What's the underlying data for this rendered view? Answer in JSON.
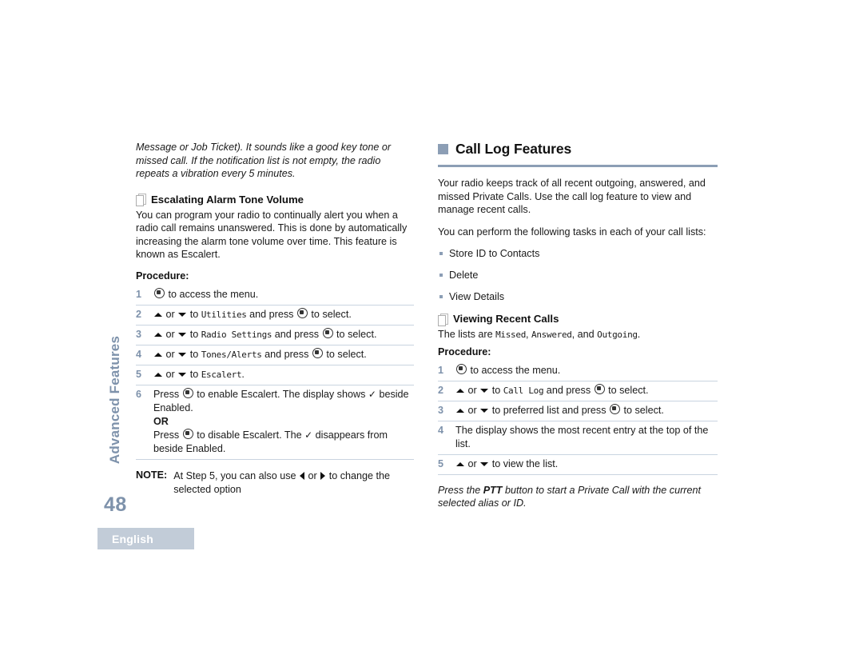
{
  "page": {
    "number": "48",
    "language_chip": "English",
    "chapter_tab": "Advanced Features"
  },
  "left_column": {
    "continued_italic_intro": "Message or Job Ticket). It sounds like a good key tone or missed call. If the notification list is not empty, the radio repeats a vibration every 5 minutes.",
    "section": {
      "heading": "Escalating Alarm Tone Volume",
      "paragraph": "You can program your radio to continually alert you when a radio call remains unanswered. This is done by automatically increasing the alarm tone volume over time. This feature is known as Escalert.",
      "procedure_label": "Procedure:",
      "steps": [
        {
          "num": "1",
          "parts": [
            {
              "type": "menu-key"
            },
            {
              "type": "text",
              "value": " to access the menu."
            }
          ]
        },
        {
          "num": "2",
          "parts": [
            {
              "type": "tri-up"
            },
            {
              "type": "text",
              "value": " or "
            },
            {
              "type": "tri-down"
            },
            {
              "type": "text",
              "value": " to "
            },
            {
              "type": "device",
              "value": "Utilities"
            },
            {
              "type": "text",
              "value": " and press "
            },
            {
              "type": "menu-key"
            },
            {
              "type": "text",
              "value": " to select."
            }
          ]
        },
        {
          "num": "3",
          "parts": [
            {
              "type": "tri-up"
            },
            {
              "type": "text",
              "value": " or "
            },
            {
              "type": "tri-down"
            },
            {
              "type": "text",
              "value": " to "
            },
            {
              "type": "device",
              "value": "Radio Settings"
            },
            {
              "type": "text",
              "value": " and press "
            },
            {
              "type": "menu-key"
            },
            {
              "type": "text",
              "value": " to select."
            }
          ]
        },
        {
          "num": "4",
          "parts": [
            {
              "type": "tri-up"
            },
            {
              "type": "text",
              "value": " or "
            },
            {
              "type": "tri-down"
            },
            {
              "type": "text",
              "value": " to "
            },
            {
              "type": "device",
              "value": "Tones/Alerts"
            },
            {
              "type": "text",
              "value": " and press "
            },
            {
              "type": "menu-key"
            },
            {
              "type": "text",
              "value": " to select."
            }
          ]
        },
        {
          "num": "5",
          "parts": [
            {
              "type": "tri-up"
            },
            {
              "type": "text",
              "value": " or "
            },
            {
              "type": "tri-down"
            },
            {
              "type": "text",
              "value": " to "
            },
            {
              "type": "device",
              "value": "Escalert"
            },
            {
              "type": "text",
              "value": "."
            }
          ]
        },
        {
          "num": "6",
          "parts": [
            {
              "type": "text",
              "value": "Press "
            },
            {
              "type": "menu-key"
            },
            {
              "type": "text",
              "value": " to enable Escalert. The display shows "
            },
            {
              "type": "check"
            },
            {
              "type": "text",
              "value": " beside Enabled."
            },
            {
              "type": "break"
            },
            {
              "type": "bold",
              "value": "OR"
            },
            {
              "type": "break"
            },
            {
              "type": "text",
              "value": "Press "
            },
            {
              "type": "menu-key"
            },
            {
              "type": "text",
              "value": " to disable Escalert. The "
            },
            {
              "type": "check"
            },
            {
              "type": "text",
              "value": " disappears from beside Enabled."
            }
          ]
        }
      ],
      "note": {
        "label": "NOTE:",
        "parts": [
          {
            "type": "text",
            "value": "At Step 5, you can also use "
          },
          {
            "type": "tri-left"
          },
          {
            "type": "text",
            "value": " or "
          },
          {
            "type": "tri-right"
          },
          {
            "type": "text",
            "value": " to change the selected option"
          }
        ]
      }
    }
  },
  "right_column": {
    "heading": "Call Log Features",
    "paragraph_1": "Your radio keeps track of all recent outgoing, answered, and missed Private Calls. Use the call log feature to view and manage recent calls.",
    "paragraph_2": "You can perform the following tasks in each of your call lists:",
    "task_list": [
      "Store ID to Contacts",
      "Delete",
      "View Details"
    ],
    "subsection": {
      "heading": "Viewing Recent Calls",
      "lists_line": [
        {
          "type": "text",
          "value": "The lists are "
        },
        {
          "type": "device",
          "value": "Missed"
        },
        {
          "type": "text",
          "value": ", "
        },
        {
          "type": "device",
          "value": "Answered"
        },
        {
          "type": "text",
          "value": ", and "
        },
        {
          "type": "device",
          "value": "Outgoing"
        },
        {
          "type": "text",
          "value": "."
        }
      ],
      "procedure_label": "Procedure:",
      "steps": [
        {
          "num": "1",
          "parts": [
            {
              "type": "menu-key"
            },
            {
              "type": "text",
              "value": " to access the menu."
            }
          ]
        },
        {
          "num": "2",
          "parts": [
            {
              "type": "tri-up"
            },
            {
              "type": "text",
              "value": " or "
            },
            {
              "type": "tri-down"
            },
            {
              "type": "text",
              "value": " to "
            },
            {
              "type": "device",
              "value": "Call Log"
            },
            {
              "type": "text",
              "value": " and press "
            },
            {
              "type": "menu-key"
            },
            {
              "type": "text",
              "value": " to select."
            }
          ]
        },
        {
          "num": "3",
          "parts": [
            {
              "type": "tri-up"
            },
            {
              "type": "text",
              "value": " or "
            },
            {
              "type": "tri-down"
            },
            {
              "type": "text",
              "value": " to preferred list and press "
            },
            {
              "type": "menu-key"
            },
            {
              "type": "text",
              "value": " to select."
            }
          ]
        },
        {
          "num": "4",
          "parts": [
            {
              "type": "text",
              "value": "The display shows the most recent entry at the top of the list."
            }
          ]
        },
        {
          "num": "5",
          "parts": [
            {
              "type": "tri-up"
            },
            {
              "type": "text",
              "value": " or "
            },
            {
              "type": "tri-down"
            },
            {
              "type": "text",
              "value": " to view the list."
            }
          ]
        }
      ],
      "trailing_note": [
        {
          "type": "text",
          "value": "Press the "
        },
        {
          "type": "bold",
          "value": "PTT"
        },
        {
          "type": "text",
          "value": " button to start a Private Call with the current selected alias or ID."
        }
      ]
    }
  },
  "colors": {
    "accent_blue_gray": "#8c9eb5",
    "chip_bg": "#c2ccd8",
    "rule": "#c9d4e0",
    "text": "#1a1a1a"
  }
}
